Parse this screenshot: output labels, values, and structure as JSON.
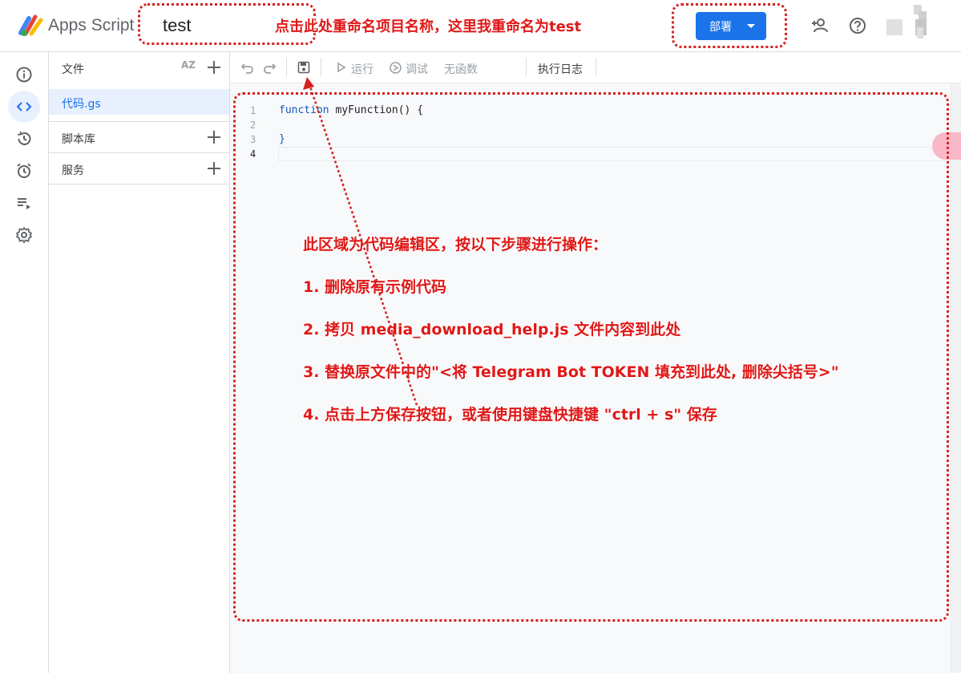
{
  "topbar": {
    "app_title": "Apps Script",
    "project_name": "test",
    "deploy_label": "部署"
  },
  "files_panel": {
    "header": "文件",
    "sort_label": "AZ",
    "file_name": "代码.gs",
    "libraries": "脚本库",
    "services": "服务"
  },
  "toolbar": {
    "run": "运行",
    "debug": "调试",
    "no_function": "无函数",
    "exec_log": "执行日志"
  },
  "editor": {
    "line_numbers": [
      "1",
      "2",
      "3",
      "4"
    ],
    "code": {
      "kw": "function",
      "name": " myFunction() {",
      "close": "}"
    }
  },
  "annotations": {
    "rename_note": "点击此处重命名项目名称，这里我重命名为test",
    "editor_note": "此区域为代码编辑区，按以下步骤进行操作：",
    "step1": "1. 删除原有示例代码",
    "step2": "2. 拷贝 media_download_help.js 文件内容到此处",
    "step3": "3. 替换原文件中的\"<将 Telegram Bot TOKEN 填充到此处, 删除尖括号>\"",
    "step4": "4. 点击上方保存按钮，或者使用键盘快捷键 \"ctrl + s\" 保存"
  },
  "colors": {
    "accent": "#1a73e8",
    "annotation_red": "#e01818"
  }
}
